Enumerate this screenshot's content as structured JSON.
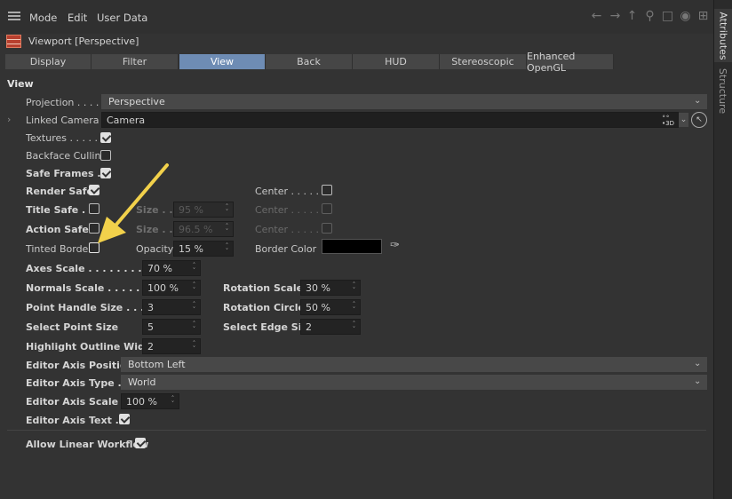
{
  "menu": {
    "mode": "Mode",
    "edit": "Edit",
    "user_data": "User Data"
  },
  "object": {
    "title": "Viewport [Perspective]"
  },
  "tabs": [
    "Display",
    "Filter",
    "View",
    "Back",
    "HUD",
    "Stereoscopic",
    "Enhanced OpenGL"
  ],
  "active_tab": "View",
  "side_tabs": {
    "attributes": "Attributes",
    "structure": "Structure"
  },
  "section": "View",
  "projection": {
    "label": "Projection . . . .",
    "value": "Perspective"
  },
  "linked_camera": {
    "label": "Linked Camera",
    "value": "Camera"
  },
  "textures": {
    "label": "Textures . . . . .",
    "checked": true
  },
  "backface": {
    "label": "Backface Culling",
    "checked": false
  },
  "safe_frames": {
    "label": "Safe Frames . .",
    "checked": true
  },
  "render_safe": {
    "label": "Render Safe",
    "checked": true,
    "center_label": "Center . . . . .",
    "center_checked": false
  },
  "title_safe": {
    "label": "Title Safe . .",
    "size_label": "Size . .",
    "size": "95 %",
    "center_label": "Center . . . . ."
  },
  "action_safe": {
    "label": "Action Safe",
    "size_label": "Size . .",
    "size": "96.5 %",
    "center_label": "Center . . . . ."
  },
  "tinted_border": {
    "label": "Tinted Border",
    "checked": false,
    "opacity_label": "Opacity",
    "opacity": "15 %",
    "color_label": "Border Color",
    "color": "#000000"
  },
  "axes_scale": {
    "label": "Axes Scale . . . . . . . . . . .",
    "value": "70 %"
  },
  "normals_scale": {
    "label": "Normals Scale . . . . . . .",
    "value": "100 %"
  },
  "rotation_scale": {
    "label": "Rotation Scale",
    "value": "30 %"
  },
  "point_handle_size": {
    "label": "Point Handle Size . . . . .",
    "value": "3"
  },
  "rotation_circle": {
    "label": "Rotation Circle",
    "value": "50 %"
  },
  "select_point_size": {
    "label": "Select Point Size",
    "value": "5"
  },
  "select_edge_size": {
    "label": "Select Edge Size",
    "value": "2"
  },
  "highlight_outline_width": {
    "label": "Highlight Outline Width",
    "value": "2"
  },
  "editor_axis_position": {
    "label": "Editor Axis Position",
    "value": "Bottom Left"
  },
  "editor_axis_type": {
    "label": "Editor Axis Type . .",
    "value": "World"
  },
  "editor_axis_scale": {
    "label": "Editor Axis Scale . .",
    "value": "100 %"
  },
  "editor_axis_text": {
    "label": "Editor Axis Text . .",
    "checked": true
  },
  "allow_linear_workflow": {
    "label": "Allow Linear Workflow",
    "checked": true
  },
  "colors": {
    "active_tab": "#6e8cb4",
    "arrow": "#f2d14b",
    "background": "#333333"
  }
}
